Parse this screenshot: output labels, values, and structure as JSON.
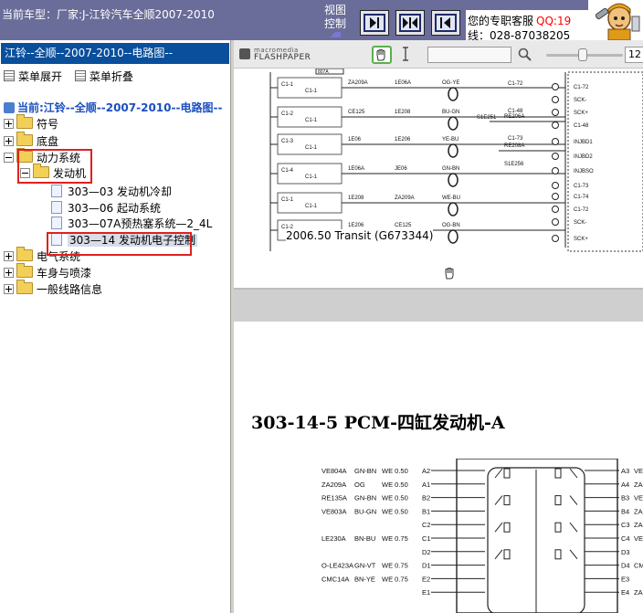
{
  "header": {
    "car_model_label": "当前车型：厂家:J-江铃汽车全顺2007-2010",
    "view_control": [
      "视图",
      "控制"
    ],
    "nav_buttons": {
      "next": "next-page-icon",
      "expand": "expand-icon",
      "prev": "prev-page-icon"
    },
    "service": {
      "label": "您的专职客服",
      "qq": "QQ:19",
      "phone": "线：028-87038205"
    },
    "mascot": "mascot-icon"
  },
  "tree": {
    "title": "江铃--全顺--2007-2010--电路图--",
    "expand_all": "菜单展开",
    "collapse_all": "菜单折叠",
    "current_path": "当前:江铃--全顺--2007-2010--电路图--",
    "nodes": [
      {
        "label": "符号"
      },
      {
        "label": "底盘"
      },
      {
        "label": "动力系统"
      },
      {
        "label": "发动机"
      },
      {
        "label": "303—03 发动机冷却"
      },
      {
        "label": "303—06 起动系统"
      },
      {
        "label": "303—07A预热塞系统—2_4L"
      },
      {
        "label": "303—14 发动机电子控制"
      },
      {
        "label": "电气系统"
      },
      {
        "label": "车身与喷漆"
      },
      {
        "label": "一般线路信息"
      }
    ],
    "highlight_color": "#e02020",
    "title_bg": "#0a4f9c"
  },
  "viewer": {
    "logo_line1": "macromedia",
    "logo_line2": "FLASHPAPER",
    "search_value": "",
    "zoom_value": "12",
    "page1": {
      "caption": "2006.50 Transit (G673344)",
      "codes_left": [
        "ZA209A",
        "CE125",
        "1E06",
        "1E06A",
        "1E208",
        "1E206",
        "JE06"
      ],
      "codes_mid": [
        "OG-YE",
        "BU-GN",
        "YE-BU",
        "GN-BN",
        "WE-BU",
        "OG-BN",
        "BU-OG"
      ],
      "codes_right": [
        "S1E251",
        "RE206A",
        "RE208A",
        "S1E256"
      ],
      "pin_labels": [
        "C1-72",
        "SCK-",
        "SCK+",
        "C1-48",
        "INJBD1",
        "INJBD2",
        "INJBSO",
        "C1-73",
        "C1-74"
      ],
      "connector_tags": [
        "C1-1",
        "C1-2",
        "C1-3",
        "C1-4"
      ]
    },
    "page2": {
      "heading": "303-14-5 PCM-四缸发动机-A",
      "rows": [
        {
          "code": "VE804A",
          "color": "GN-BN",
          "spec": "WE 0.50",
          "pin": "A2",
          "right_pin": "A3",
          "right_code": "VE"
        },
        {
          "code": "ZA209A",
          "color": "OG",
          "spec": "WE 0.50",
          "pin": "A1",
          "right_pin": "A4",
          "right_code": "ZA"
        },
        {
          "code": "RE135A",
          "color": "GN-BN",
          "spec": "WE 0.50",
          "pin": "B2",
          "right_pin": "B3",
          "right_code": "VE"
        },
        {
          "code": "VE803A",
          "color": "BU-GN",
          "spec": "WE 0.50",
          "pin": "B1",
          "right_pin": "B4",
          "right_code": "ZA"
        },
        {
          "code": "",
          "color": "",
          "spec": "",
          "pin": "C2",
          "right_pin": "C3",
          "right_code": "ZA"
        },
        {
          "code": "LE230A",
          "color": "BN-BU",
          "spec": "WE 0.75",
          "pin": "C1",
          "right_pin": "C4",
          "right_code": "VE"
        },
        {
          "code": "",
          "color": "",
          "spec": "",
          "pin": "D2",
          "right_pin": "D3",
          "right_code": ""
        },
        {
          "code": "O-LE423A",
          "color": "GN-VT",
          "spec": "WE 0.75",
          "pin": "D1",
          "right_pin": "D4",
          "right_code": "CM"
        },
        {
          "code": "CMC14A",
          "color": "BN-YE",
          "spec": "WE 0.75",
          "pin": "E2",
          "right_pin": "E3",
          "right_code": ""
        },
        {
          "code": "",
          "color": "",
          "spec": "",
          "pin": "E1",
          "right_pin": "E4",
          "right_code": "ZA"
        }
      ]
    }
  }
}
